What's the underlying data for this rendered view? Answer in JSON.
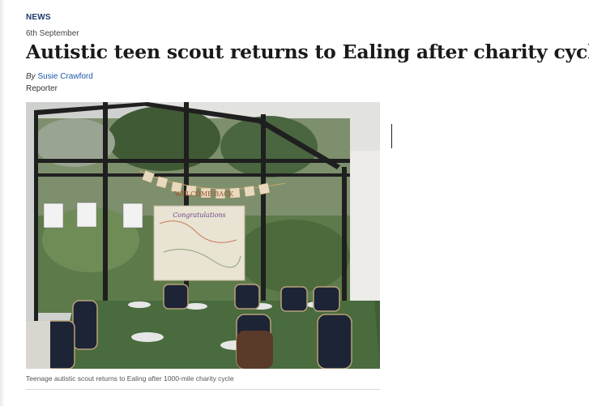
{
  "article": {
    "section": "NEWS",
    "date": "6th September",
    "headline": "Autistic teen scout returns to Ealing after charity cycle",
    "byline": {
      "prefix": "By",
      "author": "Susie Crawford",
      "role": "Reporter"
    },
    "image": {
      "banner_text": "WELCOME BACK",
      "sign_text": "Congratulations"
    },
    "caption": "Teenage autistic scout returns to Ealing after 1000-mile charity cycle"
  }
}
